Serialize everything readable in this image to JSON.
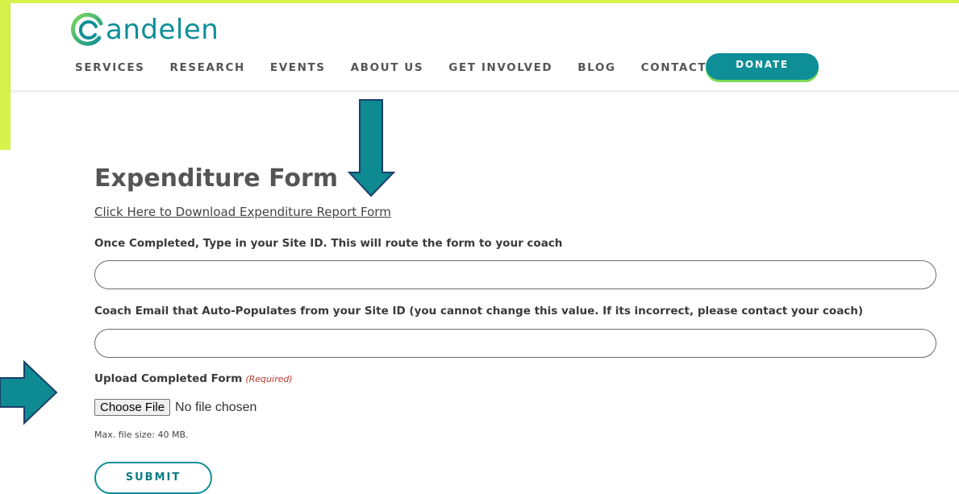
{
  "brand": {
    "name": "andelen",
    "accent": "#0e8f97",
    "accent_green": "#7ed957",
    "frame_color": "#d6f24b"
  },
  "nav": {
    "items": [
      "SERVICES",
      "RESEARCH",
      "EVENTS",
      "ABOUT US",
      "GET INVOLVED",
      "BLOG",
      "CONTACT"
    ],
    "donate_label": "DONATE"
  },
  "form": {
    "title": "Expenditure Form",
    "download_link": "Click Here to Download Expenditure Report Form",
    "site_id_label": "Once Completed, Type in your Site ID. This will route the form to your coach",
    "site_id_value": "",
    "coach_email_label": "Coach Email that Auto-Populates from your Site ID (you cannot change this value. If its incorrect, please contact your coach)",
    "coach_email_value": "",
    "upload_label": "Upload Completed Form",
    "upload_required": "(Required)",
    "choose_file_label": "Choose File",
    "file_status": "No file chosen",
    "max_size": "Max. file size: 40 MB.",
    "submit_label": "SUBMIT"
  },
  "annotations": {
    "arrow_color": "#0e8a93",
    "arrow_stroke": "#1b3f6b",
    "icons": [
      "arrow-down-icon",
      "arrow-right-icon"
    ]
  }
}
